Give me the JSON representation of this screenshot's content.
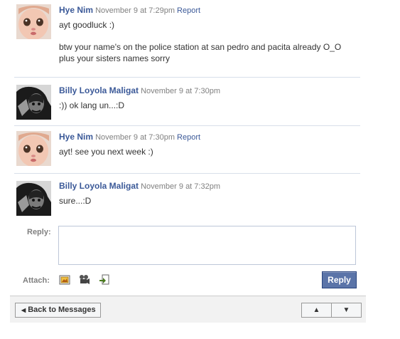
{
  "messages": [
    {
      "author": "Hye Nim",
      "timestamp": "November 9 at 7:29pm",
      "report_label": "Report",
      "avatar_icon": "baby-photo",
      "paragraphs": [
        "ayt goodluck :)",
        "btw your name's on the police station at san pedro and pacita already O_O plus your sisters names sorry"
      ]
    },
    {
      "author": "Billy Loyola Maligat",
      "timestamp": "November 9 at 7:30pm",
      "report_label": "",
      "avatar_icon": "bw-portrait",
      "paragraphs": [
        ":)) ok lang un...:D"
      ]
    },
    {
      "author": "Hye Nim",
      "timestamp": "November 9 at 7:30pm",
      "report_label": "Report",
      "avatar_icon": "baby-photo",
      "paragraphs": [
        "ayt! see you next week :)"
      ]
    },
    {
      "author": "Billy Loyola Maligat",
      "timestamp": "November 9 at 7:32pm",
      "report_label": "",
      "avatar_icon": "bw-portrait",
      "paragraphs": [
        "sure...:D"
      ]
    }
  ],
  "reply": {
    "label": "Reply:",
    "value": "",
    "attach_label": "Attach:",
    "button_label": "Reply",
    "attach_icons": [
      "photo-icon",
      "video-icon",
      "link-icon"
    ]
  },
  "footer": {
    "back_label": "Back to Messages",
    "up_arrow": "▲",
    "down_arrow": "▼"
  },
  "colors": {
    "link": "#3b5998",
    "timestamp": "#808080",
    "button": "#5b74a8"
  }
}
